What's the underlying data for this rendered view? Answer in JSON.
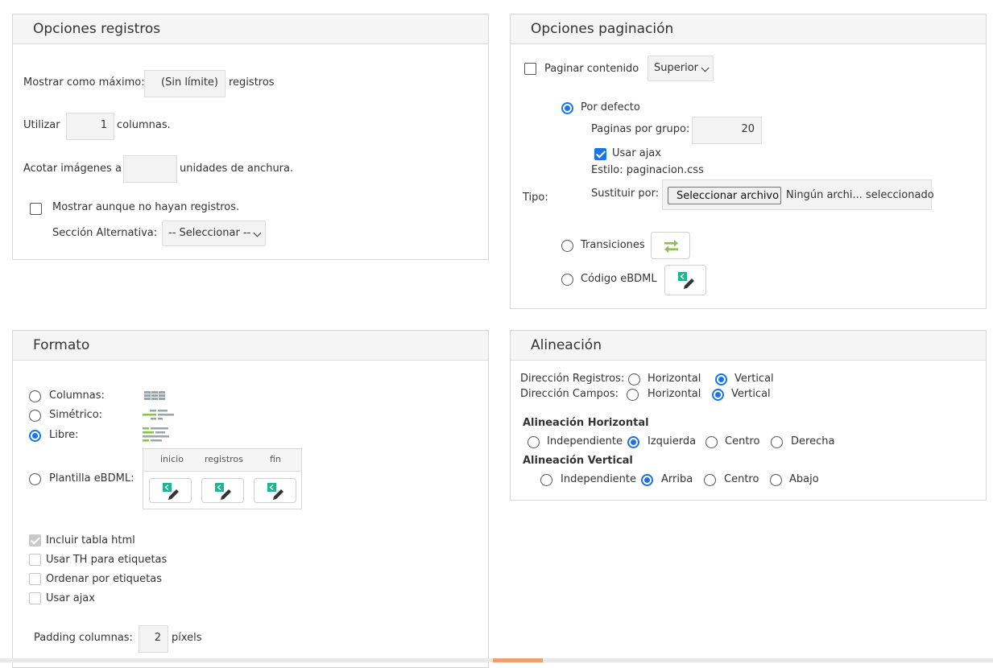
{
  "registros": {
    "title": "Opciones registros",
    "max_label": "Mostrar como máximo:",
    "max_value": "(Sin límite)",
    "max_suffix": "registros",
    "cols_prefix": "Utilizar",
    "cols_value": "1",
    "cols_suffix": "columnas.",
    "img_prefix": "Acotar imágenes a",
    "img_value": "",
    "img_suffix": "unidades de anchura.",
    "show_empty_label": "Mostrar aunque no hayan registros.",
    "show_empty_checked": false,
    "alt_section_label": "Sección Alternativa:",
    "alt_section_value": "-- Seleccionar --"
  },
  "paginacion": {
    "title": "Opciones paginación",
    "paginar_label": "Paginar contenido",
    "paginar_checked": false,
    "position_value": "Superior",
    "tipo_label": "Tipo:",
    "defecto_label": "Por defecto",
    "paginas_label": "Paginas por grupo:",
    "paginas_value": "20",
    "ajax_label": "Usar ajax",
    "ajax_checked": true,
    "estilo_label": "Estilo: paginacion.css",
    "sustituir_label": "Sustituir por:",
    "file_button": "Seleccionar archivo",
    "file_status": "Ningún archi... seleccionado",
    "transiciones_label": "Transiciones",
    "codigo_label": "Código eBDML",
    "selected_tipo": "defecto"
  },
  "formato": {
    "title": "Formato",
    "columnas_label": "Columnas:",
    "simetrico_label": "Simétrico:",
    "libre_label": "Libre:",
    "plantilla_label": "Plantilla eBDML:",
    "selected": "libre",
    "plantilla_headers": [
      "inicio",
      "registros",
      "fin"
    ],
    "incluir_tabla_label": "Incluir tabla html",
    "usar_th_label": "Usar TH para etiquetas",
    "ordenar_label": "Ordenar por etiquetas",
    "usar_ajax_label": "Usar ajax",
    "padding_label": "Padding columnas:",
    "padding_value": "2",
    "padding_suffix": "píxels"
  },
  "alineacion": {
    "title": "Alineación",
    "dir_registros_label": "Dirección Registros:",
    "dir_campos_label": "Dirección Campos:",
    "horizontal_label": "Horizontal",
    "vertical_label": "Vertical",
    "dir_registros_value": "Vertical",
    "dir_campos_value": "Vertical",
    "h_title": "Alineación Horizontal",
    "h_options": [
      "Independiente",
      "Izquierda",
      "Centro",
      "Derecha"
    ],
    "h_value": "Izquierda",
    "v_title": "Alineación Vertical",
    "v_options": [
      "Independiente",
      "Arriba",
      "Centro",
      "Abajo"
    ],
    "v_value": "Arriba"
  },
  "colors": {
    "accent": "#1a73e8",
    "icon_green": "#8bc34a",
    "icon_teal": "#1fb58e",
    "scroll_accent": "#f0a070"
  }
}
